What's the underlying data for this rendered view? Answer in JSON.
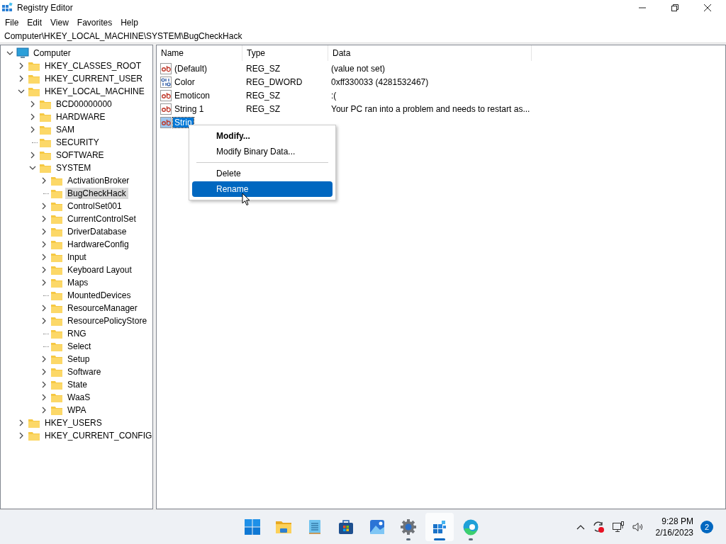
{
  "window": {
    "title": "Registry Editor"
  },
  "menu_bar": [
    "File",
    "Edit",
    "View",
    "Favorites",
    "Help"
  ],
  "address_bar": {
    "value": "Computer\\HKEY_LOCAL_MACHINE\\SYSTEM\\BugCheckHack"
  },
  "tree": [
    {
      "label": "Computer",
      "expandable": true,
      "expanded": true,
      "selected": false,
      "children": [
        {
          "label": "HKEY_CLASSES_ROOT",
          "expandable": true,
          "selected": false
        },
        {
          "label": "HKEY_CURRENT_USER",
          "expandable": true,
          "selected": false
        },
        {
          "label": "HKEY_LOCAL_MACHINE",
          "expandable": true,
          "expanded": true,
          "selected": false,
          "children": [
            {
              "label": "BCD00000000",
              "expandable": true,
              "selected": false
            },
            {
              "label": "HARDWARE",
              "expandable": true,
              "selected": false
            },
            {
              "label": "SAM",
              "expandable": true,
              "selected": false
            },
            {
              "label": "SECURITY",
              "expandable": false,
              "selected": false
            },
            {
              "label": "SOFTWARE",
              "expandable": true,
              "selected": false
            },
            {
              "label": "SYSTEM",
              "expandable": true,
              "expanded": true,
              "selected": false,
              "children": [
                {
                  "label": "ActivationBroker",
                  "expandable": true,
                  "selected": false
                },
                {
                  "label": "BugCheckHack",
                  "expandable": false,
                  "selected": true
                },
                {
                  "label": "ControlSet001",
                  "expandable": true,
                  "selected": false
                },
                {
                  "label": "CurrentControlSet",
                  "expandable": true,
                  "selected": false
                },
                {
                  "label": "DriverDatabase",
                  "expandable": true,
                  "selected": false
                },
                {
                  "label": "HardwareConfig",
                  "expandable": true,
                  "selected": false
                },
                {
                  "label": "Input",
                  "expandable": true,
                  "selected": false
                },
                {
                  "label": "Keyboard Layout",
                  "expandable": true,
                  "selected": false
                },
                {
                  "label": "Maps",
                  "expandable": true,
                  "selected": false
                },
                {
                  "label": "MountedDevices",
                  "expandable": false,
                  "selected": false
                },
                {
                  "label": "ResourceManager",
                  "expandable": true,
                  "selected": false
                },
                {
                  "label": "ResourcePolicyStore",
                  "expandable": true,
                  "selected": false
                },
                {
                  "label": "RNG",
                  "expandable": false,
                  "selected": false
                },
                {
                  "label": "Select",
                  "expandable": false,
                  "selected": false
                },
                {
                  "label": "Setup",
                  "expandable": true,
                  "selected": false
                },
                {
                  "label": "Software",
                  "expandable": true,
                  "selected": false
                },
                {
                  "label": "State",
                  "expandable": true,
                  "selected": false
                },
                {
                  "label": "WaaS",
                  "expandable": true,
                  "selected": false
                },
                {
                  "label": "WPA",
                  "expandable": true,
                  "selected": false
                }
              ]
            }
          ]
        },
        {
          "label": "HKEY_USERS",
          "expandable": true,
          "selected": false
        },
        {
          "label": "HKEY_CURRENT_CONFIG",
          "expandable": true,
          "selected": false
        }
      ]
    }
  ],
  "values": {
    "columns": [
      "Name",
      "Type",
      "Data"
    ],
    "rows": [
      {
        "kind": "string",
        "name": "(Default)",
        "type": "REG_SZ",
        "data": "(value not set)",
        "selected": false
      },
      {
        "kind": "binary",
        "name": "Color",
        "type": "REG_DWORD",
        "data": "0xff330033 (4281532467)",
        "selected": false
      },
      {
        "kind": "string",
        "name": "Emoticon",
        "type": "REG_SZ",
        "data": ":(",
        "selected": false
      },
      {
        "kind": "string",
        "name": "String 1",
        "type": "REG_SZ",
        "data": "Your PC  ran into a problem and needs to restart as...",
        "selected": false
      },
      {
        "kind": "string",
        "name": "Strin",
        "selected": true
      }
    ]
  },
  "context_menu": [
    {
      "kind": "item",
      "label": "Modify...",
      "default": true,
      "selected": false
    },
    {
      "kind": "item",
      "label": "Modify Binary Data...",
      "default": false,
      "selected": false
    },
    {
      "kind": "separator"
    },
    {
      "kind": "item",
      "label": "Delete",
      "default": false,
      "selected": false
    },
    {
      "kind": "item",
      "label": "Rename",
      "default": false,
      "selected": true
    }
  ],
  "taskbar": {
    "apps": [
      {
        "running": false,
        "active": false
      },
      {
        "running": false,
        "active": false
      },
      {
        "running": false,
        "active": false
      },
      {
        "running": false,
        "active": false
      },
      {
        "running": false,
        "active": false
      },
      {
        "running": true,
        "active": false
      },
      {
        "running": true,
        "active": true
      },
      {
        "running": true,
        "active": false
      }
    ],
    "time": "9:28 PM",
    "date": "2/16/2023",
    "notifications": "2"
  }
}
